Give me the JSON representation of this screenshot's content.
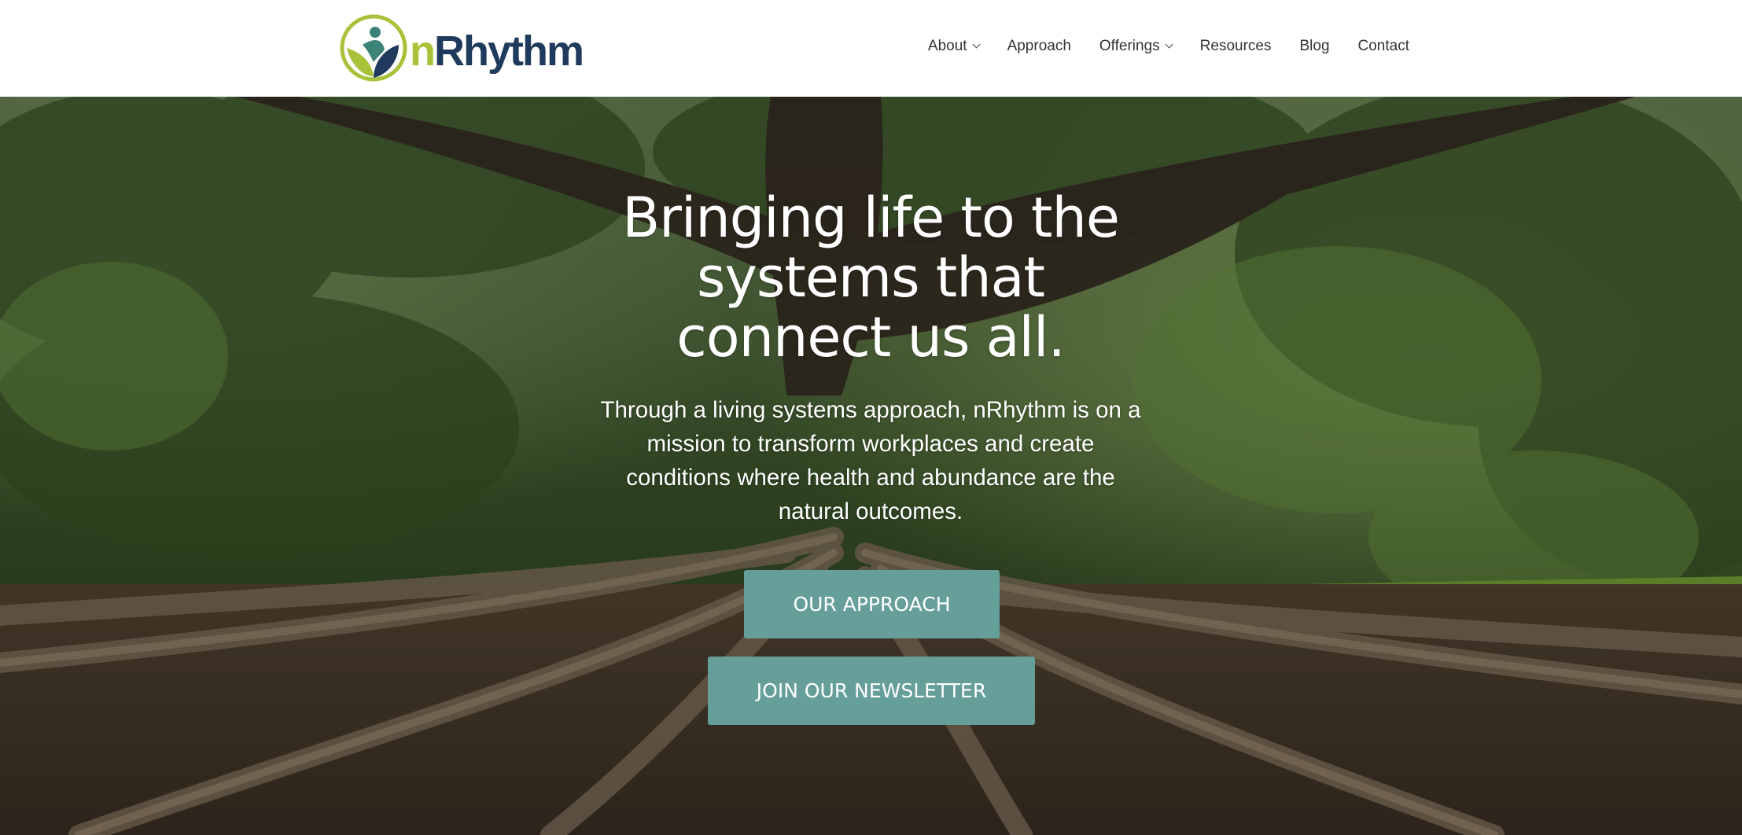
{
  "brand": {
    "name_prefix": "n",
    "name_rest": "Rhythm",
    "colors": {
      "navy": "#1f3a5c",
      "lime": "#a8c23a",
      "teal_button": "#669f99"
    }
  },
  "nav": {
    "items": [
      {
        "label": "About",
        "has_dropdown": true
      },
      {
        "label": "Approach",
        "has_dropdown": false
      },
      {
        "label": "Offerings",
        "has_dropdown": true
      },
      {
        "label": "Resources",
        "has_dropdown": false
      },
      {
        "label": "Blog",
        "has_dropdown": false
      },
      {
        "label": "Contact",
        "has_dropdown": false
      }
    ]
  },
  "hero": {
    "title_line1": "Bringing life to the",
    "title_line2": "systems that",
    "title_line3": "connect us all.",
    "subtitle": "Through a living systems approach, nRhythm is on a mission to transform workplaces and create conditions where health and abundance are the natural outcomes.",
    "buttons": {
      "approach": "OUR APPROACH",
      "newsletter": "JOIN OUR NEWSLETTER"
    },
    "background_image": "banyan tree with sprawling roots in a park"
  }
}
